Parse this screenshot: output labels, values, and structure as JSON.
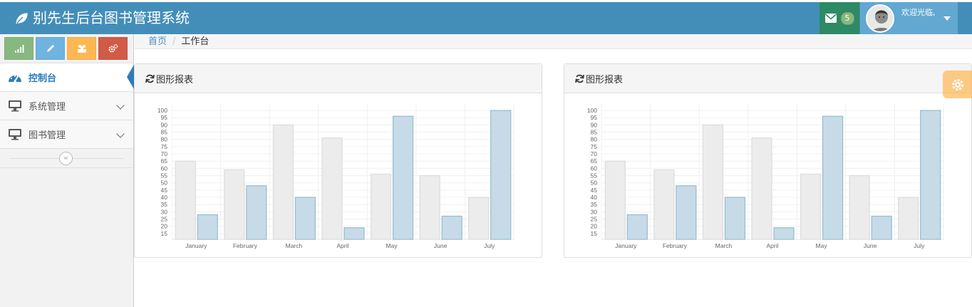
{
  "app": {
    "title": "别先生后台图书管理系统"
  },
  "navbar": {
    "mail_badge": "5",
    "welcome": "欢迎光临,"
  },
  "colors": {
    "navbar": "#438eb9",
    "mail_bg": "#2e8965",
    "user_bg": "#62a8d1",
    "sc_success": "#87b87f",
    "sc_info": "#6fb3e0",
    "sc_warning": "#ffb752",
    "sc_danger": "#d15b47",
    "bar_series1_fill": "#ececec",
    "bar_series1_stroke": "#dcdcdc",
    "bar_series2_fill": "#c6dbe7",
    "bar_series2_stroke": "#97bbcd"
  },
  "sidebar": {
    "shortcuts": [
      {
        "icon": "signal-icon"
      },
      {
        "icon": "pencil-icon"
      },
      {
        "icon": "users-icon"
      },
      {
        "icon": "cogs-icon"
      }
    ],
    "items": [
      {
        "label": "控制台",
        "icon": "tachometer-icon",
        "active": true
      },
      {
        "label": "系统管理",
        "icon": "desktop-icon",
        "active": false
      },
      {
        "label": "图书管理",
        "icon": "desktop-icon",
        "active": false
      }
    ]
  },
  "breadcrumb": {
    "home": "首页",
    "current": "工作台"
  },
  "panels": [
    {
      "title": "图形报表"
    },
    {
      "title": "图形报表"
    }
  ],
  "chart_data": [
    {
      "type": "bar",
      "categories": [
        "January",
        "February",
        "March",
        "April",
        "May",
        "June",
        "July"
      ],
      "series": [
        {
          "values": [
            65,
            59,
            90,
            81,
            56,
            55,
            40
          ]
        },
        {
          "values": [
            28,
            48,
            40,
            19,
            96,
            27,
            100
          ]
        }
      ],
      "y_ticks": [
        15,
        20,
        25,
        30,
        35,
        40,
        45,
        50,
        55,
        60,
        65,
        70,
        75,
        80,
        85,
        90,
        95,
        100
      ],
      "ylim": [
        11,
        102
      ],
      "grid": true
    },
    {
      "type": "bar",
      "categories": [
        "January",
        "February",
        "March",
        "April",
        "May",
        "June",
        "July"
      ],
      "series": [
        {
          "values": [
            65,
            59,
            90,
            81,
            56,
            55,
            40
          ]
        },
        {
          "values": [
            28,
            48,
            40,
            19,
            96,
            27,
            100
          ]
        }
      ],
      "y_ticks": [
        15,
        20,
        25,
        30,
        35,
        40,
        45,
        50,
        55,
        60,
        65,
        70,
        75,
        80,
        85,
        90,
        95,
        100
      ],
      "ylim": [
        11,
        102
      ],
      "grid": true
    }
  ]
}
